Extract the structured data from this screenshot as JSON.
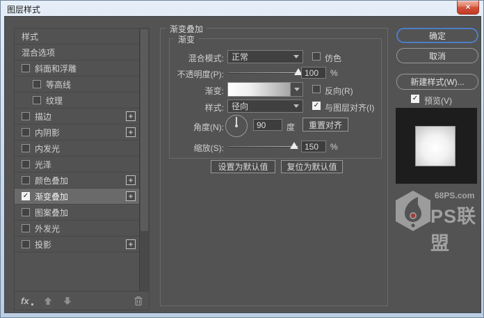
{
  "window": {
    "title": "图层样式",
    "close_symbol": "×"
  },
  "sidebar": {
    "items": [
      {
        "label": "样式",
        "checkbox": false,
        "checked": false,
        "plus": false,
        "indent": false,
        "selected": false
      },
      {
        "label": "混合选项",
        "checkbox": false,
        "checked": false,
        "plus": false,
        "indent": false,
        "selected": false
      },
      {
        "label": "斜面和浮雕",
        "checkbox": true,
        "checked": false,
        "plus": false,
        "indent": false,
        "selected": false
      },
      {
        "label": "等高线",
        "checkbox": true,
        "checked": false,
        "plus": false,
        "indent": true,
        "selected": false
      },
      {
        "label": "纹理",
        "checkbox": true,
        "checked": false,
        "plus": false,
        "indent": true,
        "selected": false
      },
      {
        "label": "描边",
        "checkbox": true,
        "checked": false,
        "plus": true,
        "indent": false,
        "selected": false
      },
      {
        "label": "内阴影",
        "checkbox": true,
        "checked": false,
        "plus": true,
        "indent": false,
        "selected": false
      },
      {
        "label": "内发光",
        "checkbox": true,
        "checked": false,
        "plus": false,
        "indent": false,
        "selected": false
      },
      {
        "label": "光泽",
        "checkbox": true,
        "checked": false,
        "plus": false,
        "indent": false,
        "selected": false
      },
      {
        "label": "颜色叠加",
        "checkbox": true,
        "checked": false,
        "plus": true,
        "indent": false,
        "selected": false
      },
      {
        "label": "渐变叠加",
        "checkbox": true,
        "checked": true,
        "plus": true,
        "indent": false,
        "selected": true
      },
      {
        "label": "图案叠加",
        "checkbox": true,
        "checked": false,
        "plus": false,
        "indent": false,
        "selected": false
      },
      {
        "label": "外发光",
        "checkbox": true,
        "checked": false,
        "plus": false,
        "indent": false,
        "selected": false
      },
      {
        "label": "投影",
        "checkbox": true,
        "checked": false,
        "plus": true,
        "indent": false,
        "selected": false
      }
    ],
    "footer": {
      "fx_label": "fx"
    }
  },
  "panel": {
    "title": "渐变叠加",
    "group_title": "渐变",
    "blend_mode": {
      "label": "混合模式:",
      "value": "正常",
      "dither": {
        "label": "仿色",
        "checked": false
      }
    },
    "opacity": {
      "label": "不透明度(P):",
      "value": "100",
      "unit": "%",
      "percent": 100
    },
    "gradient": {
      "label": "渐变:",
      "reverse": {
        "label": "反向(R)",
        "checked": false
      }
    },
    "style": {
      "label": "样式:",
      "value": "径向",
      "align": {
        "label": "与图层对齐(I)",
        "checked": true
      }
    },
    "angle": {
      "label": "角度(N):",
      "value": "90",
      "unit": "度",
      "reset_label": "重置对齐"
    },
    "scale": {
      "label": "缩放(S):",
      "value": "150",
      "unit": "%",
      "percent": 94
    },
    "defaults": {
      "set_label": "设置为默认值",
      "reset_label": "复位为默认值"
    }
  },
  "actions": {
    "ok": "确定",
    "cancel": "取消",
    "new_style": "新建样式(W)...",
    "preview": {
      "label": "预览(V)",
      "checked": true
    }
  },
  "watermark": {
    "site": "68PS.com",
    "name": "PS联盟"
  },
  "colors": {
    "dialog_bg": "#535353",
    "selected_row": "#6a6a6a",
    "accent_blue": "#4d7ec6",
    "close_red": "#d4523e",
    "watermark_dot": "#c23131"
  }
}
